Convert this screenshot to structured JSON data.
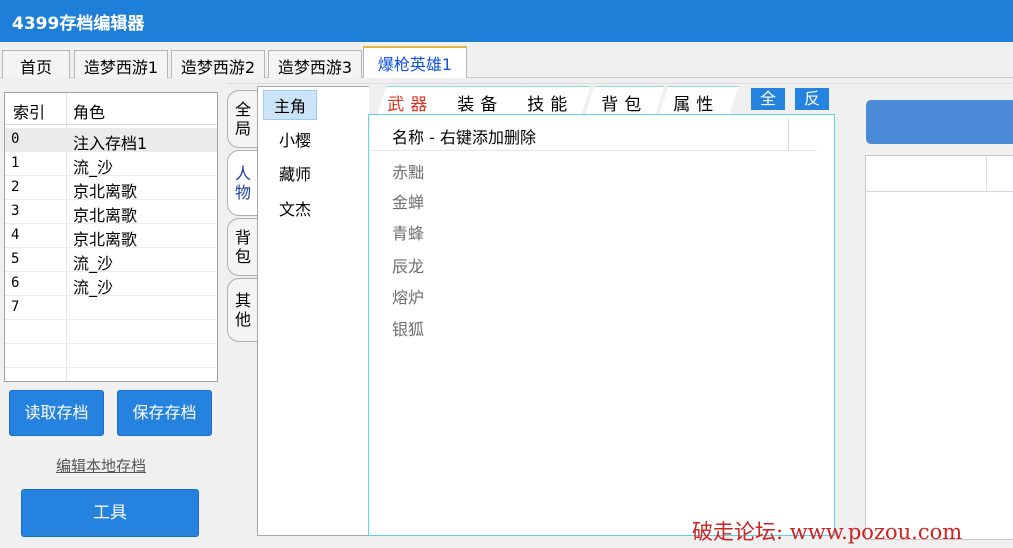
{
  "app": {
    "title": "4399存档编辑器"
  },
  "top_tabs": [
    "首页",
    "造梦西游1",
    "造梦西游2",
    "造梦西游3",
    "爆枪英雄1"
  ],
  "list": {
    "headers": [
      "索引",
      "角色"
    ],
    "rows": [
      [
        "0",
        "注入存档1"
      ],
      [
        "1",
        "流_沙"
      ],
      [
        "2",
        "京北离歌"
      ],
      [
        "3",
        "京北离歌"
      ],
      [
        "4",
        "京北离歌"
      ],
      [
        "5",
        "流_沙"
      ],
      [
        "6",
        "流_沙"
      ],
      [
        "7",
        ""
      ]
    ]
  },
  "buttons": {
    "read": "读取存档",
    "save": "保存存档",
    "edit_local": "编辑本地存档",
    "tools": "工具"
  },
  "side_tabs": [
    "全局",
    "人物",
    "背包",
    "其他"
  ],
  "roles": [
    "主角",
    "小樱",
    "藏师",
    "文杰"
  ],
  "weapon_tabs": [
    "武器",
    "装备",
    "技能",
    "背包",
    "属性"
  ],
  "small_buttons": {
    "all": "全",
    "invert": "反"
  },
  "grid": {
    "header": "名称 - 右键添加删除",
    "items": [
      "赤黜",
      "金蝉",
      "青蜂",
      "辰龙",
      "熔炉",
      "银狐"
    ]
  },
  "watermark": "破走论坛: www.pozou.com"
}
